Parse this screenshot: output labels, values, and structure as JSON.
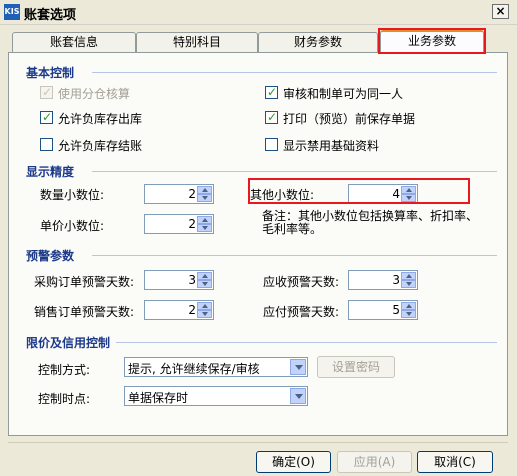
{
  "window": {
    "title": "账套选项",
    "icon_text": "KIS",
    "close_glyph": "×"
  },
  "tabs": [
    {
      "label": "账套信息",
      "active": false
    },
    {
      "label": "特别科目",
      "active": false
    },
    {
      "label": "财务参数",
      "active": false
    },
    {
      "label": "业务参数",
      "active": true
    }
  ],
  "basic_control": {
    "title": "基本控制",
    "options": [
      {
        "label": "使用分仓核算",
        "checked": true,
        "enabled": false
      },
      {
        "label": "审核和制单可为同一人",
        "checked": true,
        "enabled": true
      },
      {
        "label": "允许负库存出库",
        "checked": true,
        "enabled": true
      },
      {
        "label": "打印（预览）前保存单据",
        "checked": true,
        "enabled": true
      },
      {
        "label": "允许负库存结账",
        "checked": false,
        "enabled": true
      },
      {
        "label": "显示禁用基础资料",
        "checked": false,
        "enabled": true
      }
    ]
  },
  "precision": {
    "title": "显示精度",
    "quantity_label": "数量小数位:",
    "quantity_value": "2",
    "price_label": "单价小数位:",
    "price_value": "2",
    "other_label": "其他小数位:",
    "other_value": "4",
    "note": "备注：其他小数位包括换算率、折扣率、毛利率等。"
  },
  "warning": {
    "title": "预警参数",
    "purchase_label": "采购订单预警天数:",
    "purchase_value": "3",
    "receivable_label": "应收预警天数:",
    "receivable_value": "3",
    "sales_label": "销售订单预警天数:",
    "sales_value": "2",
    "payable_label": "应付预警天数:",
    "payable_value": "5"
  },
  "credit": {
    "title": "限价及信用控制",
    "method_label": "控制方式:",
    "method_value": "提示, 允许继续保存/审核",
    "set_password_label": "设置密码",
    "point_label": "控制时点:",
    "point_value": "单据保存时"
  },
  "footer": {
    "ok_label": "确定(O)",
    "apply_label": "应用(A)",
    "cancel_label": "取消(C)"
  },
  "colors": {
    "accent": "#e68b2c",
    "highlight": "#e8181e",
    "section_title": "#1d3a8a"
  }
}
